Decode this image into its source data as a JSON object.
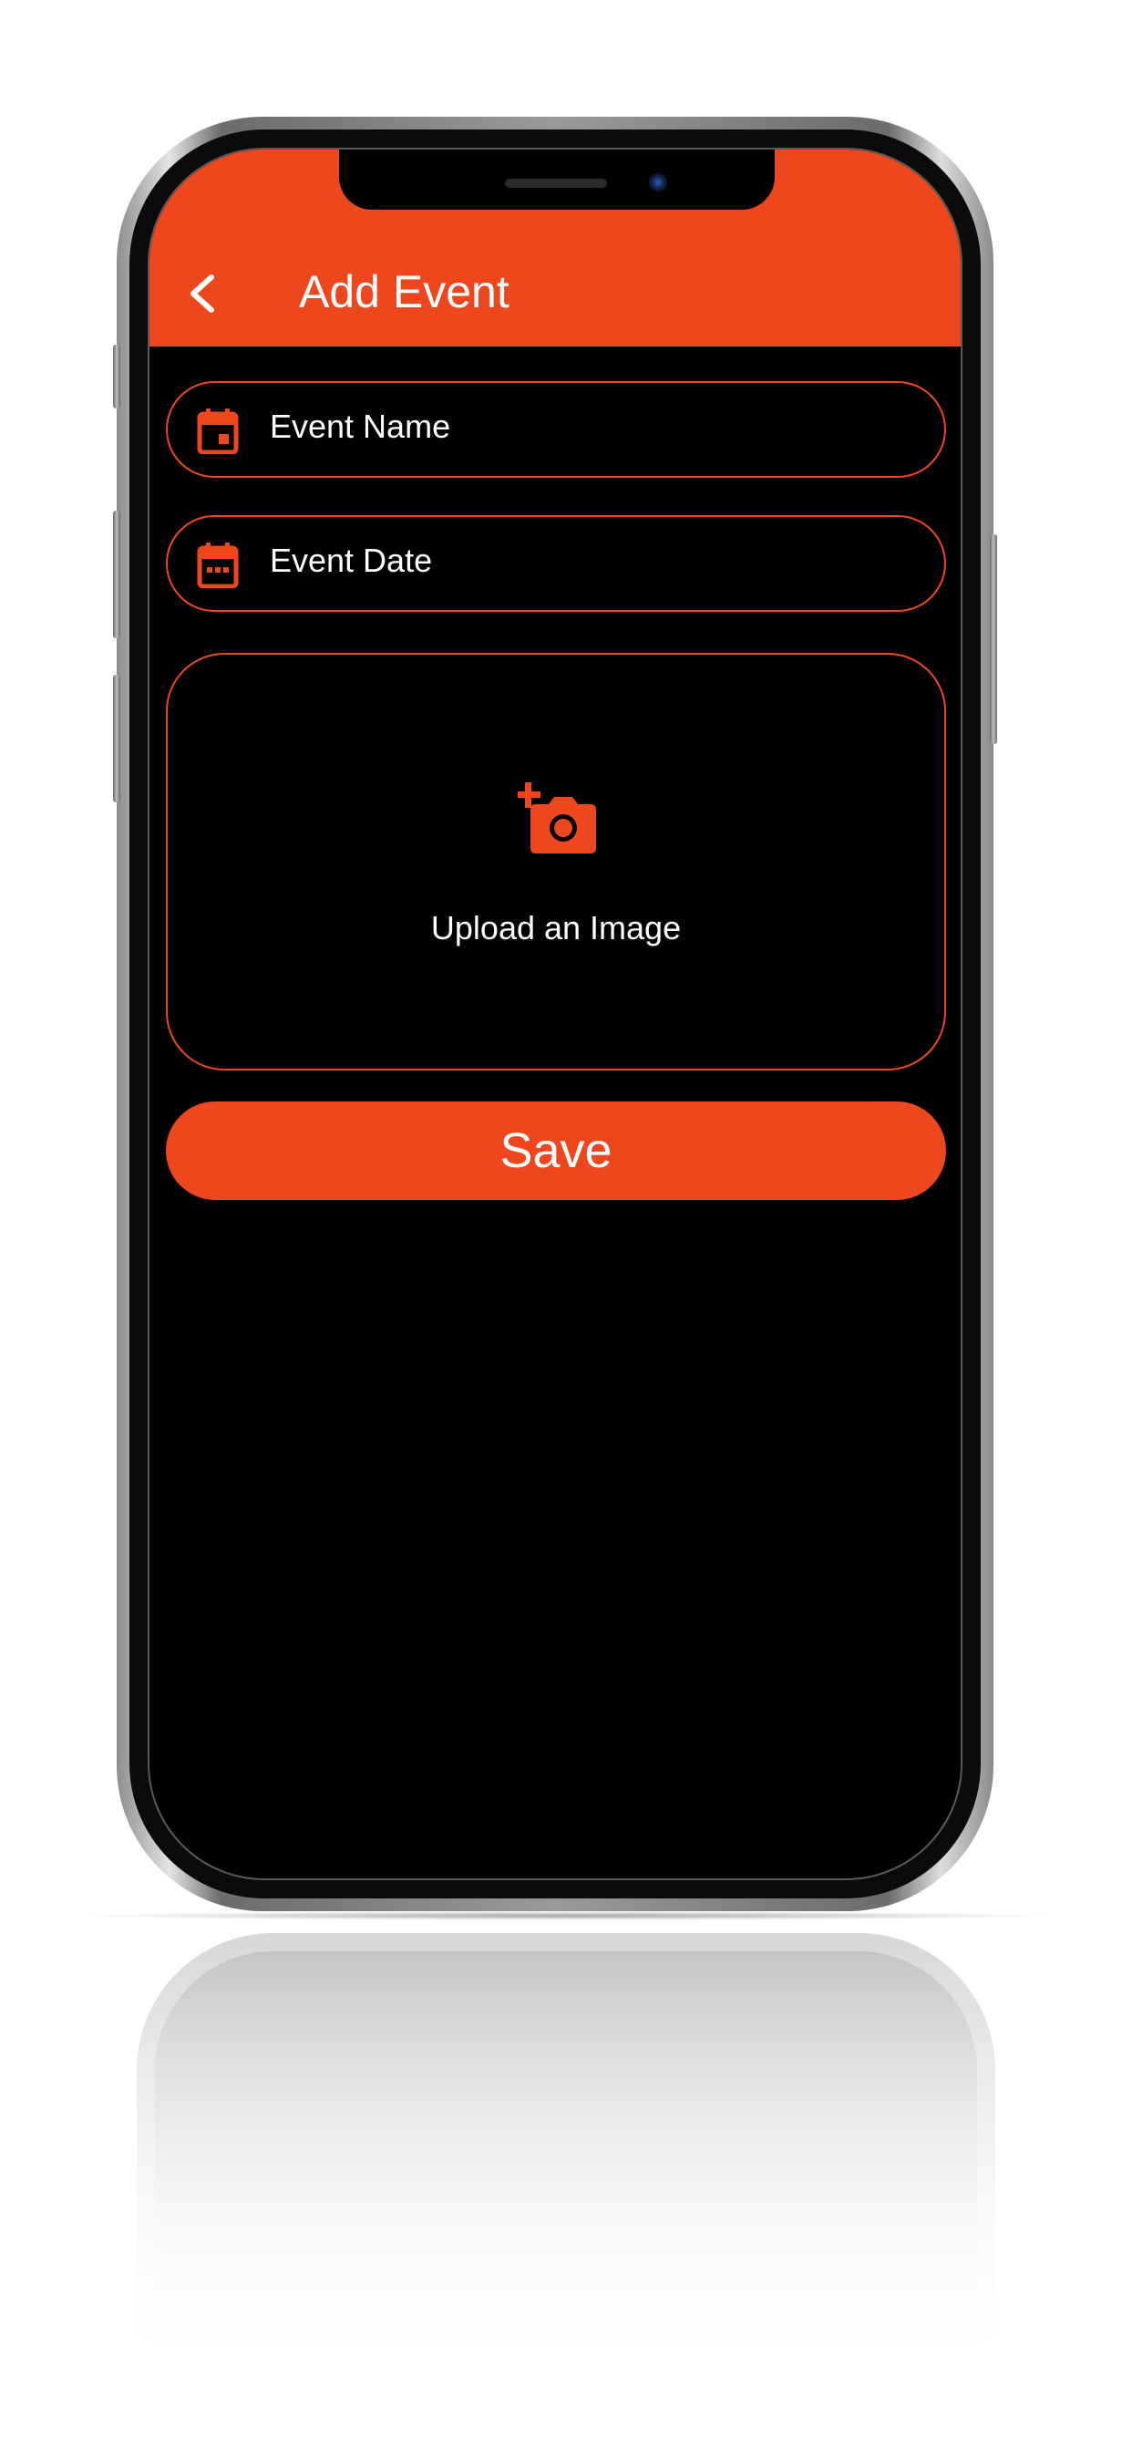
{
  "app_bar": {
    "title": "Add Event",
    "back_icon": "chevron-left-icon"
  },
  "form": {
    "event_name": {
      "placeholder": "Event Name",
      "icon": "calendar-event-icon"
    },
    "event_date": {
      "placeholder": "Event Date",
      "icon": "calendar-date-icon"
    },
    "upload": {
      "label": "Upload an Image",
      "icon": "add-photo-camera-icon"
    },
    "save_label": "Save"
  },
  "theme": {
    "accent": "#ee471d",
    "background": "#000000",
    "text": "#ffffff"
  }
}
